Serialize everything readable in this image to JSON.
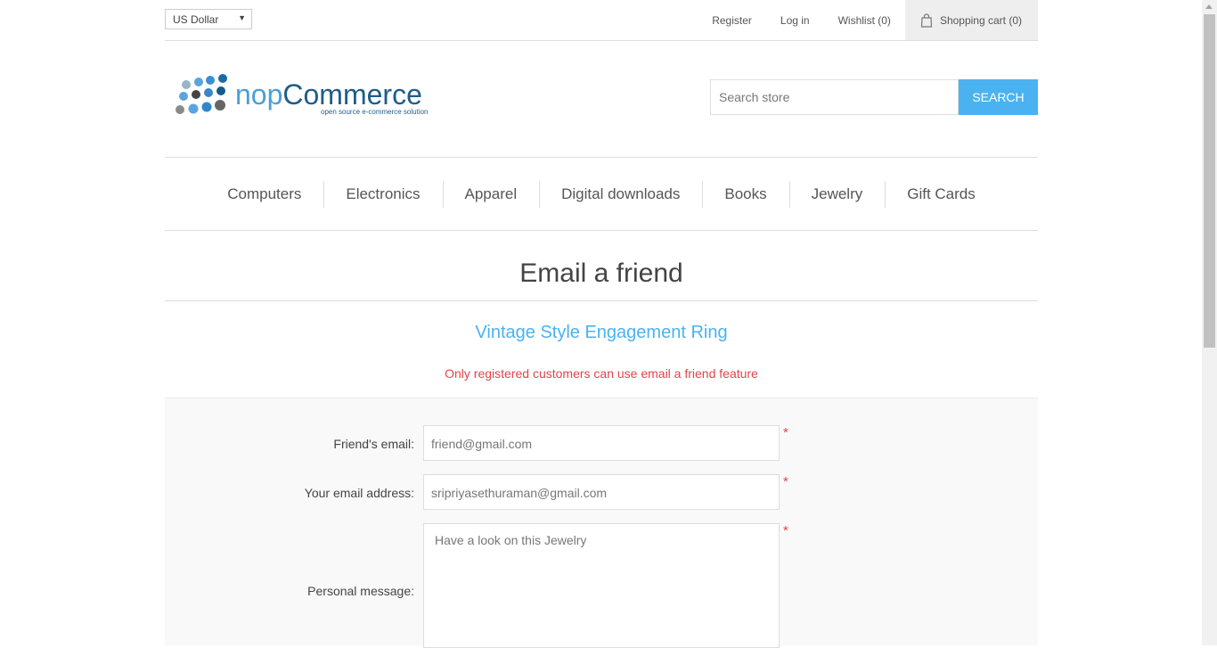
{
  "header": {
    "currency": "US Dollar",
    "links": {
      "register": "Register",
      "login": "Log in",
      "wishlist": "Wishlist (0)",
      "cart": "Shopping cart (0)"
    }
  },
  "logo": {
    "name": "nopCommerce",
    "tagline": "open source e-commerce solution"
  },
  "search": {
    "placeholder": "Search store",
    "button": "SEARCH"
  },
  "menu": [
    "Computers",
    "Electronics",
    "Apparel",
    "Digital downloads",
    "Books",
    "Jewelry",
    "Gift Cards"
  ],
  "page": {
    "title": "Email a friend",
    "product": "Vintage Style Engagement Ring",
    "error": "Only registered customers can use email a friend feature"
  },
  "form": {
    "friend_email_label": "Friend's email:",
    "friend_email_value": "friend@gmail.com",
    "your_email_label": "Your email address:",
    "your_email_value": "sripriyasethuraman@gmail.com",
    "message_label": "Personal message:",
    "message_value": "Have a look on this Jewelry",
    "required_mark": "*"
  },
  "colors": {
    "accent": "#4ab2f1",
    "error": "#e4434b"
  }
}
